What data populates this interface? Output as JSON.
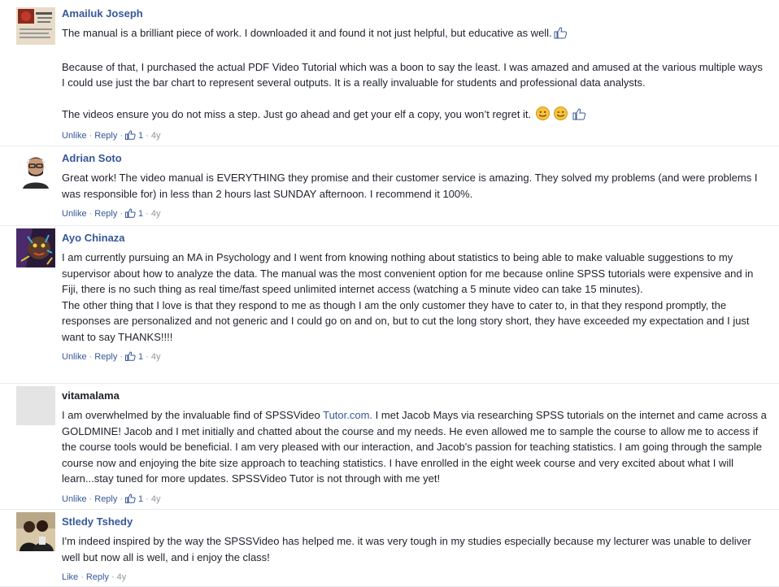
{
  "comments": [
    {
      "author": "Amailuk Joseph",
      "p1": "The manual is a brilliant piece of work. I downloaded it and found it not just helpful, but educative as well.",
      "p2": "Because of that, I purchased the actual PDF Video Tutorial which was a boon to say the least. I was amazed and amused at the various multiple ways I could use just the bar chart to represent several outputs. It is a really invaluable for students and professional data analysts.",
      "p3": "The videos ensure you do not miss a step. Just go ahead and get your elf a copy, you won’t regret it.",
      "actions": {
        "like": "Unlike",
        "reply": "Reply",
        "count": "1",
        "age": "4y"
      }
    },
    {
      "author": "Adrian Soto",
      "p1": "Great work! The video manual is EVERYTHING they promise and their customer service is amazing. They solved my problems (and were problems I was responsible for) in less than 2 hours last SUNDAY afternoon. I recommend it 100%.",
      "actions": {
        "like": "Unlike",
        "reply": "Reply",
        "count": "1",
        "age": "4y"
      }
    },
    {
      "author": "Ayo Chinaza",
      "p1": "I am currently pursuing an MA in Psychology and I went from knowing nothing about statistics to being able to make valuable suggestions to my supervisor about how to analyze the data. The manual was the most convenient option for me because online SPSS tutorials were expensive and in Fiji, there is no such thing as real time/fast speed unlimited internet access (watching a 5 minute video can take 15 minutes).",
      "p2": "The other thing that I love is that they respond to me as though I am the only customer they have to cater to, in that they respond promptly, the responses are personalized and not generic and I could go on and on, but to cut the long story short, they have exceeded my expectation and I just want to say THANKS!!!!",
      "actions": {
        "like": "Unlike",
        "reply": "Reply",
        "count": "1",
        "age": "4y"
      }
    },
    {
      "author": "vitamalama",
      "p1_before": "I am overwhelmed by the invaluable find of SPSSVideo ",
      "p1_link": "Tutor.com.",
      "p1_after": " I met Jacob Mays via researching SPSS tutorials on the internet and came across a GOLDMINE! Jacob and I met initially and chatted about the course and my needs. He even allowed me to sample the course to allow me to access if the course tools would be beneficial. I am very pleased with our interaction, and Jacob's passion for teaching statistics. I am going through the sample course now and enjoying the bite size approach to teaching statistics. I have enrolled in the eight week course and very excited about what I will learn...stay tuned for more updates. SPSSVideo Tutor is not through with me yet!",
      "actions": {
        "like": "Unlike",
        "reply": "Reply",
        "count": "1",
        "age": "4y"
      }
    },
    {
      "author": "Stledy Tshedy",
      "p1": "I'm indeed inspired by the way the SPSSVideo has helped me. it was very tough in my studies especially because my lecturer was unable to deliver well but now all is well, and i enjoy the class!",
      "actions": {
        "like": "Like",
        "reply": "Reply",
        "age": "4y"
      }
    }
  ],
  "colors": {
    "link": "#365899",
    "meta": "#90949c",
    "text": "#1d2129"
  }
}
